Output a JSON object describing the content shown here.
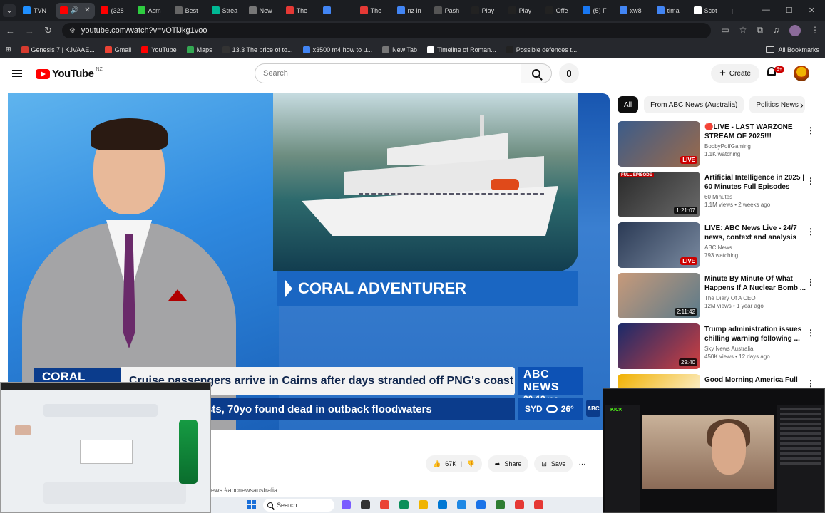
{
  "browser": {
    "tabs": [
      {
        "label": "TVN",
        "color": "#1f8fff",
        "active": false
      },
      {
        "label": "",
        "color": "#ff0000",
        "active": true,
        "audio": "🔊",
        "close": "✕"
      },
      {
        "label": "(328",
        "color": "#ff0000"
      },
      {
        "label": "Asm",
        "color": "#2ecc40"
      },
      {
        "label": "Best",
        "color": "#666666"
      },
      {
        "label": "Strea",
        "color": "#00b894"
      },
      {
        "label": "New",
        "color": "#777777"
      },
      {
        "label": "The",
        "color": "#e53935"
      },
      {
        "label": "",
        "color": "#4285f4"
      },
      {
        "label": "The",
        "color": "#e53935"
      },
      {
        "label": "nz in",
        "color": "#4285f4"
      },
      {
        "label": "Pash",
        "color": "#555555"
      },
      {
        "label": "Play",
        "color": "#222222"
      },
      {
        "label": "Play",
        "color": "#222222"
      },
      {
        "label": "Offe",
        "color": "#222222"
      },
      {
        "label": "(5) F",
        "color": "#1877f2"
      },
      {
        "label": "xw8",
        "color": "#4285f4"
      },
      {
        "label": "tima",
        "color": "#4285f4"
      },
      {
        "label": "Scot",
        "color": "#ffffff"
      }
    ],
    "new_tab": "+",
    "menu_glyph": "⌄",
    "window_controls": [
      "—",
      "☐",
      "✕"
    ],
    "url": "youtube.com/watch?v=vOTiJkg1voo",
    "bookmarks": [
      {
        "label": "Genesis 7 | KJVAAE...",
        "color": "#d63b2f"
      },
      {
        "label": "Gmail",
        "color": "#ea4335"
      },
      {
        "label": "YouTube",
        "color": "#ff0000"
      },
      {
        "label": "Maps",
        "color": "#34a853"
      },
      {
        "label": "13.3 The price of to...",
        "color": "#333333"
      },
      {
        "label": "x3500 m4 how to u...",
        "color": "#4285f4"
      },
      {
        "label": "New Tab",
        "color": "#777777"
      },
      {
        "label": "Timeline of Roman...",
        "color": "#ffffff"
      },
      {
        "label": "Possible defences t...",
        "color": "#222222"
      }
    ],
    "all_bookmarks": "All Bookmarks"
  },
  "youtube": {
    "logo": "YouTube",
    "country": "NZ",
    "search_placeholder": "Search",
    "create": "Create",
    "notifications": "9+"
  },
  "video": {
    "ship_name": "CORAL ADVENTURER",
    "ticker_tag": "CORAL",
    "headline": "Cruise passengers arrive in Cairns after days stranded off PNG's coast",
    "ticker": "sts, 70yo found dead in outback floodwaters",
    "network": "ABC NEWS",
    "time": "20:13",
    "tz": "VIC",
    "city": "SYD",
    "temp": "26°",
    "mark": "ABC"
  },
  "actions": {
    "likes": "67K",
    "share": "Share",
    "save": "Save",
    "more": "···"
  },
  "description": "ews #abcnewsaustralia",
  "chips": [
    "All",
    "From ABC News (Australia)",
    "Politics News"
  ],
  "recommendations": [
    {
      "title": "🔴LIVE - LAST WARZONE STREAM OF 2025!!!",
      "channel": "BobbyPoffGaming",
      "meta": "1.1K watching",
      "badge": "LIVE",
      "badge_type": "live",
      "bg": "linear-gradient(135deg,#3b5c8a,#9c6a4a)"
    },
    {
      "title": "Artificial Intelligence in 2025 | 60 Minutes Full Episodes",
      "channel": "60 Minutes",
      "meta": "1.1M views • 2 weeks ago",
      "badge": "1:21:07",
      "badge_type": "dur",
      "label": "FULL EPISODE",
      "bg": "linear-gradient(135deg,#2a2a2a,#6a6a6a)"
    },
    {
      "title": "LIVE: ABC News Live - 24/7 news, context and analysis",
      "channel": "ABC News",
      "meta": "793 watching",
      "badge": "LIVE",
      "badge_type": "live",
      "bg": "linear-gradient(135deg,#2b3a55,#7a8aa0)"
    },
    {
      "title": "Minute By Minute Of What Happens If A Nuclear Bomb ...",
      "channel": "The Diary Of A CEO",
      "meta": "12M views • 1 year ago",
      "badge": "2:11:42",
      "badge_type": "dur",
      "bg": "linear-gradient(135deg,#c89a7a,#5a7a8a)"
    },
    {
      "title": "Trump administration issues chilling warning following ...",
      "channel": "Sky News Australia",
      "meta": "450K views • 12 days ago",
      "badge": "29:40",
      "badge_type": "dur",
      "bg": "linear-gradient(135deg,#1a2a6a,#d04040)"
    },
    {
      "title": "Good Morning America Full",
      "channel": "",
      "meta": "",
      "badge": "",
      "badge_type": "",
      "bg": "linear-gradient(135deg,#f0b000,#ffffff)"
    }
  ],
  "taskbar": {
    "search": "Search",
    "icons": [
      "#7a5cff",
      "#333333",
      "#ea4335",
      "#0a8f5a",
      "#f0b400",
      "#0078d4",
      "#1e88e5",
      "#1a73e8",
      "#2e7d32",
      "#e53935",
      "#e53935"
    ]
  }
}
